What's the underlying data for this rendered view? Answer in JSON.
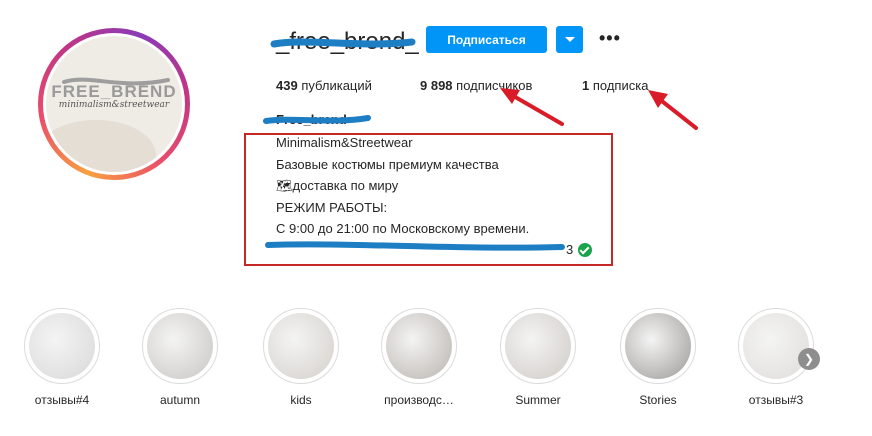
{
  "profile": {
    "username": "_free_brend_",
    "avatar": {
      "title": "FREE_BREND",
      "subtitle": "minimalism&streetwear"
    },
    "follow_label": "Подписаться",
    "stats": [
      {
        "count": "439",
        "label": "публикаций"
      },
      {
        "count": "9 898",
        "label": "подписчиков"
      },
      {
        "count": "1",
        "label": "подписка"
      }
    ],
    "bio": {
      "name": "Free_brend",
      "lines": [
        "Minimalism&Streetwear",
        "Базовые костюмы премиум качества",
        "🗺доставка по миру",
        "РЕЖИМ РАБОТЫ:",
        "С 9:00 до 21:00 по Московскому времени."
      ],
      "contact_tail": "3"
    }
  },
  "highlights": [
    {
      "label": "отзывы#4",
      "tone": "#d8d8d8"
    },
    {
      "label": "autumn",
      "tone": "#c9c6c2"
    },
    {
      "label": "kids",
      "tone": "#d4d0ca"
    },
    {
      "label": "производс…",
      "tone": "#b9b3ad"
    },
    {
      "label": "Summer",
      "tone": "#cfcac5"
    },
    {
      "label": "Stories",
      "tone": "#9d9a97"
    },
    {
      "label": "отзывы#3",
      "tone": "#e0ddd9"
    }
  ],
  "colors": {
    "annotation": "#d91c27",
    "scribble": "#1e7ec3",
    "accent": "#0095f6"
  }
}
